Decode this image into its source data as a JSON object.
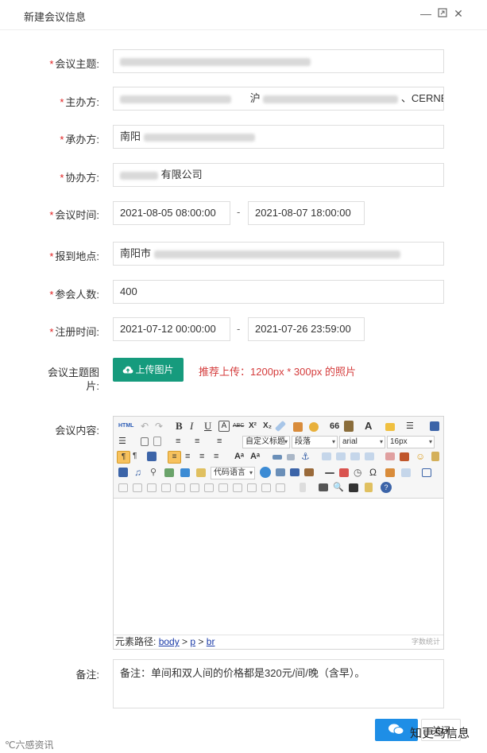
{
  "dialog": {
    "title": "新建会议信息",
    "window_buttons": [
      "minimize",
      "maximize",
      "close"
    ]
  },
  "form": {
    "topic": {
      "label": "会议主题:",
      "value": ""
    },
    "organizer": {
      "label": "主办方:",
      "value_visible": "沪",
      "value_suffix": "、CERNET"
    },
    "undertaker": {
      "label": "承办方:",
      "value": "南阳"
    },
    "co_organizer": {
      "label": "协办方:",
      "value": "有限公司"
    },
    "meeting_time": {
      "label": "会议时间:",
      "start": "2021-08-05 08:00:00",
      "end": "2021-08-07 18:00:00"
    },
    "checkin_place": {
      "label": "报到地点:",
      "value": "南阳市"
    },
    "attendees": {
      "label": "参会人数:",
      "value": "400"
    },
    "register_time": {
      "label": "注册时间:",
      "start": "2021-07-12 00:00:00",
      "end": "2021-07-26 23:59:00"
    },
    "topic_image": {
      "label_line1": "会议主题图",
      "label_line2": "片:",
      "button": "上传图片",
      "hint": "推荐上传：1200px * 300px 的照片"
    },
    "content": {
      "label": "会议内容:"
    },
    "remark": {
      "label": "备注:",
      "value": "备注：单间和双人间的价格都是320元/间/晚（含早）。"
    },
    "dash": "-",
    "required_mark": "*"
  },
  "editor": {
    "html_label": "HTML",
    "select_custom_title": "自定义标题",
    "select_paragraph": "段落",
    "select_font": "arial",
    "select_size": "16px",
    "select_code_lang": "代码语言",
    "path_label": "元素路径:",
    "path_body": "body",
    "path_sep": " > ",
    "path_p": "p",
    "path_br": "br",
    "word_count": "字数统计",
    "btn_bold": "B",
    "btn_italic": "I",
    "btn_underline": "U",
    "btn_strike": "ABC",
    "btn_superscript": "X²",
    "btn_subscript": "X₂",
    "btn_font_color": "A",
    "btn_quote": "66",
    "btn_omega": "Ω"
  },
  "footer": {
    "confirm_label": "",
    "cancel_label": "关闭"
  },
  "watermarks": {
    "left": "六感资讯",
    "right": "知更鸟信息"
  },
  "colors": {
    "primary": "#169b7d",
    "required": "#e02020",
    "hint": "#d43b3b",
    "footer_blue": "#1e8ee6"
  }
}
